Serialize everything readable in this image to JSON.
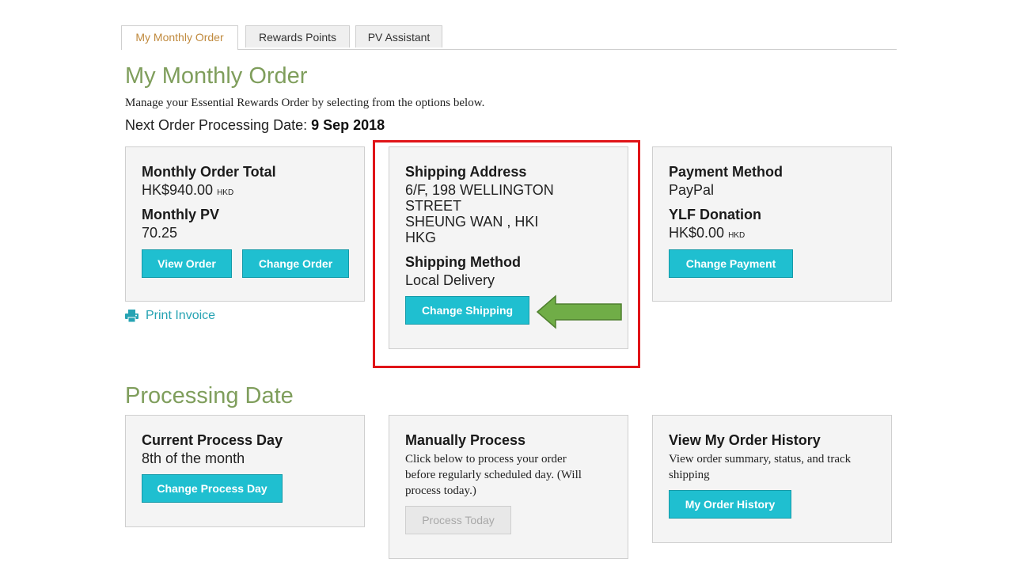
{
  "tabs": [
    {
      "label": "My Monthly Order"
    },
    {
      "label": "Rewards Points"
    },
    {
      "label": "PV Assistant"
    }
  ],
  "header": {
    "title": "My Monthly Order",
    "intro": "Manage your Essential Rewards Order by selecting from the options below.",
    "next_label": "Next Order Processing Date: ",
    "next_date": "9 Sep 2018"
  },
  "order_card": {
    "total_label": "Monthly Order Total",
    "total_value": "HK$940.00",
    "total_currency": "HKD",
    "pv_label": "Monthly PV",
    "pv_value": "70.25",
    "view_button": "View Order",
    "change_button": "Change Order"
  },
  "print_invoice": "Print Invoice",
  "shipping_card": {
    "address_label": "Shipping Address",
    "address_lines": [
      "6/F, 198 WELLINGTON",
      "STREET",
      "SHEUNG WAN , HKI",
      "HKG"
    ],
    "method_label": "Shipping Method",
    "method_value": "Local Delivery",
    "button": "Change Shipping"
  },
  "payment_card": {
    "method_label": "Payment Method",
    "method_value": "PayPal",
    "donation_label": "YLF Donation",
    "donation_value": "HK$0.00",
    "donation_currency": "HKD",
    "button": "Change Payment"
  },
  "processing": {
    "title": "Processing Date",
    "current": {
      "label": "Current Process Day",
      "value": "8th of the month",
      "button": "Change Process Day"
    },
    "manual": {
      "label": "Manually Process",
      "desc": [
        "Click below to process your order",
        "before regularly scheduled day. (Will",
        "process today.)"
      ],
      "button": "Process Today"
    },
    "history": {
      "label": "View My Order History",
      "desc": [
        "View order summary, status, and track",
        "shipping"
      ],
      "button": "My Order History"
    }
  },
  "colors": {
    "accent_teal": "#1fbfd0",
    "heading_green": "#7f9e5c",
    "highlight_red": "#e01418",
    "arrow_green": "#70ad47"
  }
}
